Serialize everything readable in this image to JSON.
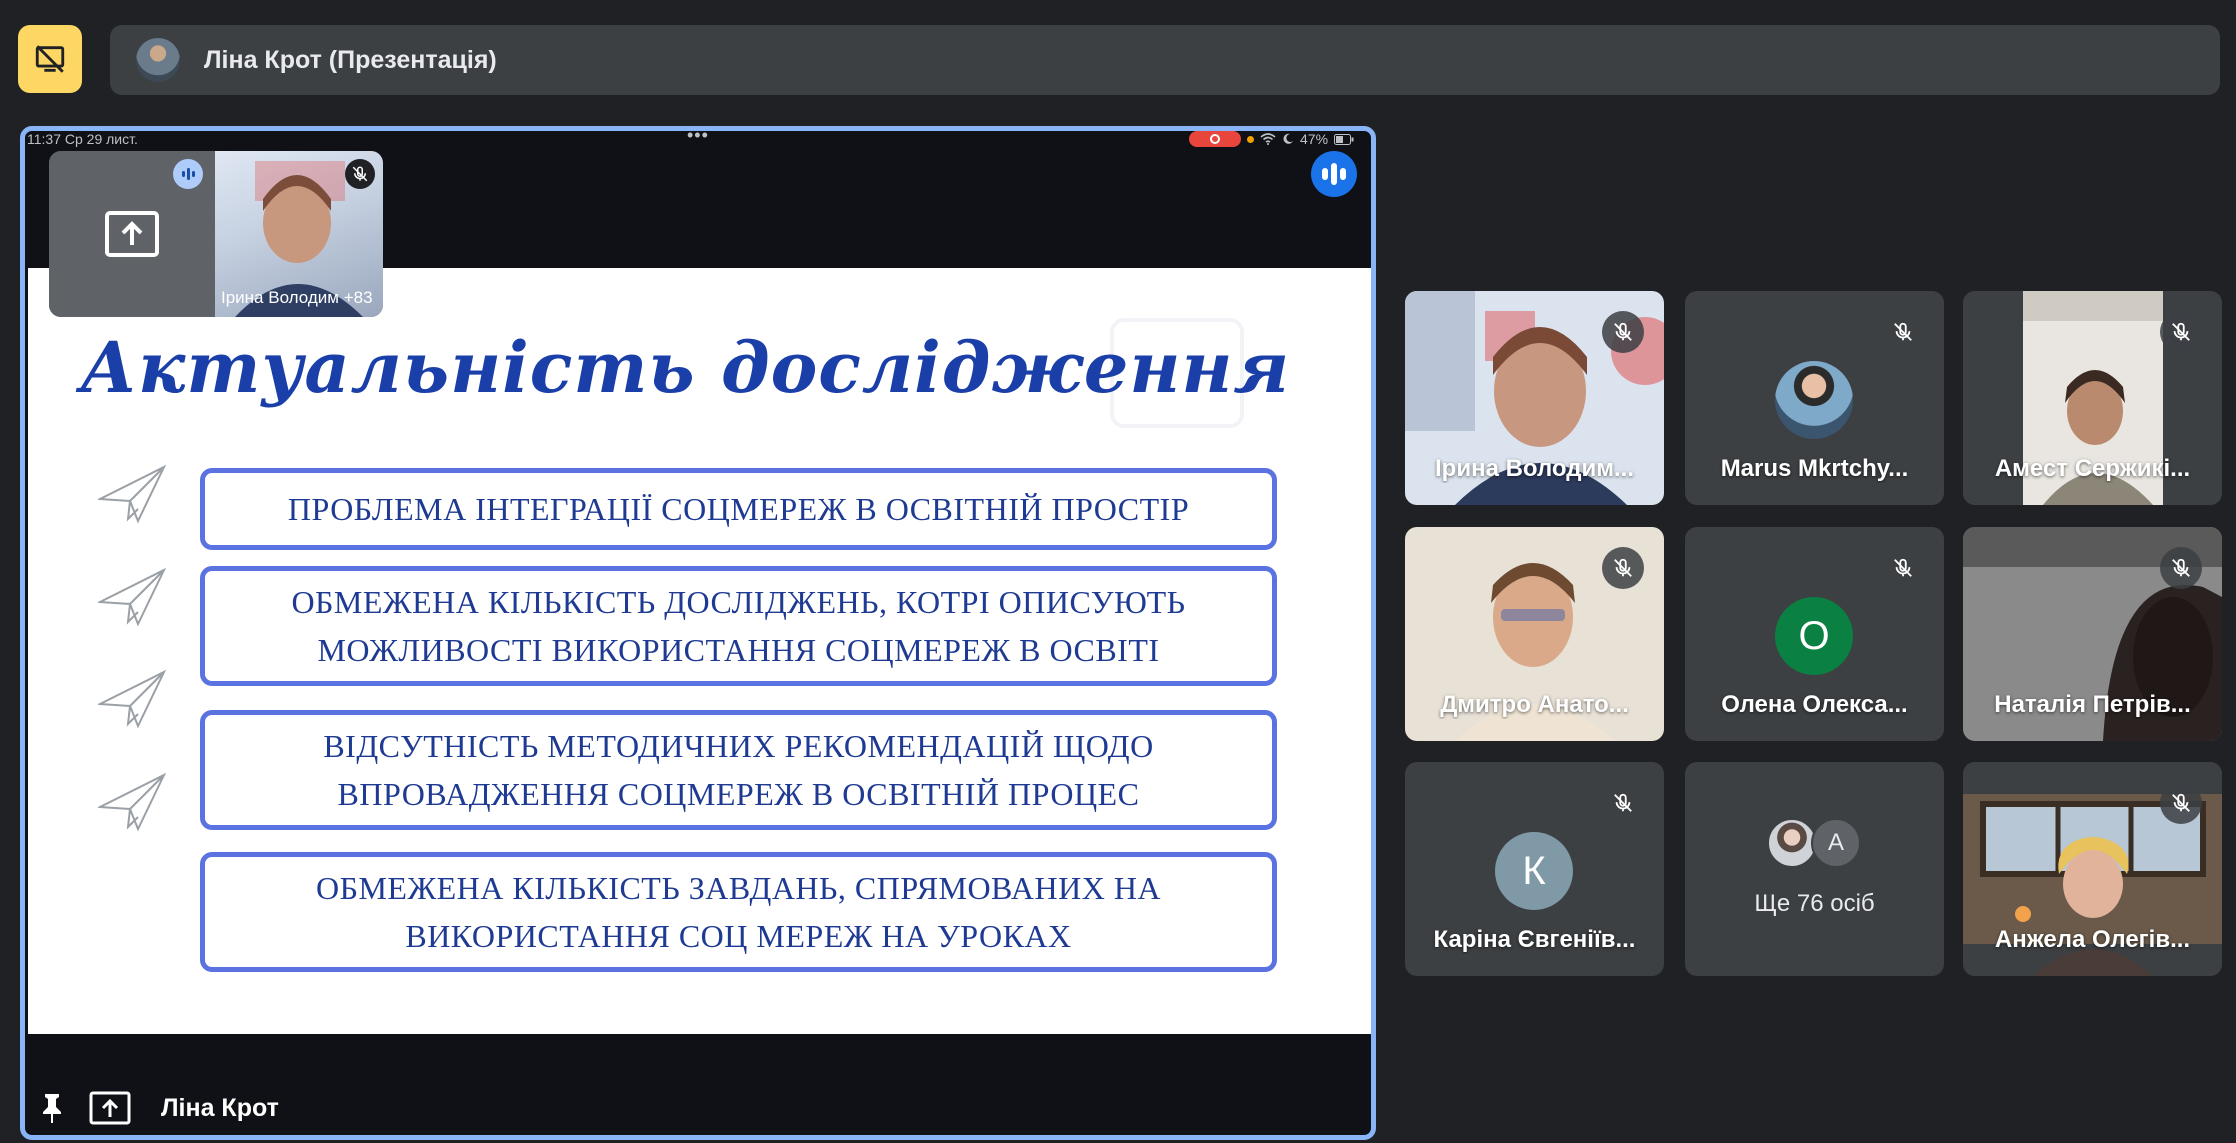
{
  "header": {
    "title": "Ліна Крот (Презентація)"
  },
  "tablet_status": {
    "time": "11:37",
    "date": "Ср 29 лист.",
    "battery": "47%"
  },
  "slide": {
    "title": "Актуальність дослідження",
    "items": [
      [
        "ПРОБЛЕМА ІНТЕГРАЦІЇ СОЦМЕРЕЖ  В ОСВІТНІЙ ПРОСТІР"
      ],
      [
        "ОБМЕЖЕНА КІЛЬКІСТЬ ДОСЛІДЖЕНЬ, КОТРІ ОПИСУЮТЬ",
        "МОЖЛИВОСТІ ВИКОРИСТАННЯ СОЦМЕРЕЖ В ОСВІТІ"
      ],
      [
        "ВІДСУТНІСТЬ МЕТОДИЧНИХ РЕКОМЕНДАЦІЙ ЩОДО",
        "ВПРОВАДЖЕННЯ СОЦМЕРЕЖ В ОСВІТНІЙ ПРОЦЕС"
      ],
      [
        "ОБМЕЖЕНА КІЛЬКІСТЬ ЗАВДАНЬ, СПРЯМОВАНИХ НА",
        "ВИКОРИСТАННЯ СОЦ МЕРЕЖ НА УРОКАХ"
      ]
    ]
  },
  "mini_tile": {
    "label": "Ірина Володим",
    "count": "+83"
  },
  "stage_footer": {
    "presenter": "Ліна Крот"
  },
  "participants": [
    {
      "name": "Ірина Володим...",
      "kind": "video"
    },
    {
      "name": "Marus Mkrtchy...",
      "kind": "photo"
    },
    {
      "name": "Амест Сержикі...",
      "kind": "video"
    },
    {
      "name": "Дмитро Анато...",
      "kind": "video"
    },
    {
      "name": "Олена Олекса...",
      "kind": "initial",
      "initial": "О",
      "color": "#0b8043"
    },
    {
      "name": "Наталія Петрів...",
      "kind": "video"
    },
    {
      "name": "Каріна Євгеніїв...",
      "kind": "initial",
      "initial": "К",
      "color": "#7f9aa6"
    },
    {
      "name": "",
      "kind": "more"
    },
    {
      "name": "Анжела Олегів...",
      "kind": "video"
    }
  ],
  "more_tile": {
    "label": "Ще 76 осіб",
    "initial": "А"
  },
  "colors": {
    "accent": "#8ab4f8",
    "present_button": "#fdd663",
    "slide_text": "#1e3a93",
    "slide_border": "#5b73e0"
  }
}
